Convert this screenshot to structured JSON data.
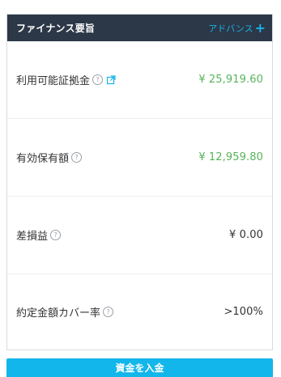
{
  "panel": {
    "title": "ファイナンス要旨",
    "advance_label": "アドバンス",
    "advance_plus": "+"
  },
  "rows": [
    {
      "label": "利用可能証拠金",
      "help": "?",
      "value": "¥ 25,919.60",
      "value_color": "#57b45a",
      "has_link_icon": true
    },
    {
      "label": "有効保有額",
      "help": "?",
      "value": "¥ 12,959.80",
      "value_color": "#57b45a"
    },
    {
      "label": "差損益",
      "help": "?",
      "value": "¥ 0.00",
      "value_color": "#333333"
    },
    {
      "label": "約定金額カバー率",
      "help": "?",
      "value": ">100%",
      "value_color": "#333333"
    }
  ],
  "deposit_button": {
    "label": "資金を入金"
  },
  "colors": {
    "header_bg": "#2c3847",
    "accent": "#19b2e8",
    "positive": "#57b45a",
    "button_bg": "#13b6ea"
  },
  "icons": {
    "help": "question-circle-icon",
    "link": "external-link-icon",
    "plus": "plus-icon"
  }
}
